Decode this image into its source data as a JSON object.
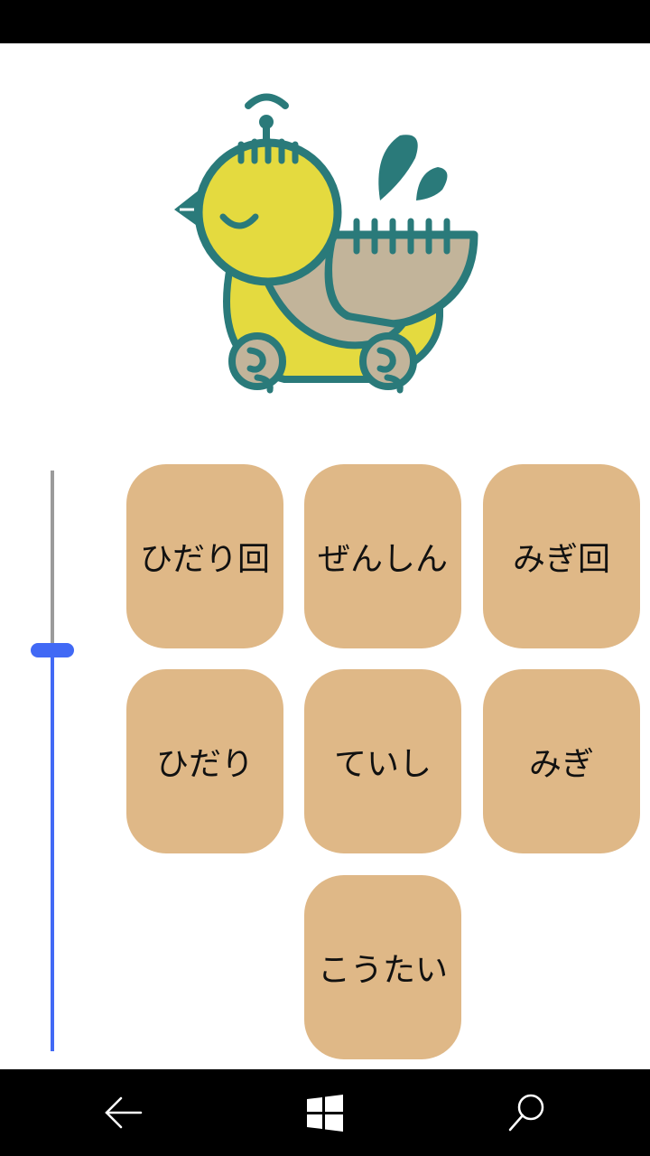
{
  "controls": {
    "turn_left": "ひだり回",
    "forward": "ぜんしん",
    "turn_right": "みぎ回",
    "left": "ひだり",
    "stop": "ていし",
    "right": "みぎ",
    "backward": "こうたい"
  },
  "speed_slider": {
    "value_fraction": 0.69
  },
  "colors": {
    "button_bg": "#dfb887",
    "slider_accent": "#4169f5",
    "slider_track": "#9b9b9b",
    "bird_body": "#e4da3f",
    "bird_outline": "#2a7a7a",
    "bird_wing": "#c2b49a"
  },
  "nav": {
    "back_icon": "back-arrow-icon",
    "start_icon": "windows-icon",
    "search_icon": "search-icon"
  }
}
